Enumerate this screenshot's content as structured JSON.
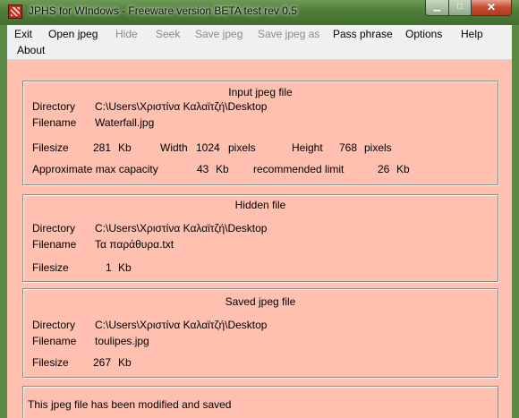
{
  "window": {
    "title": "JPHS for WIndows - Freeware version BETA test rev 0.5",
    "min_glyph": "▁",
    "max_glyph": "□",
    "close_glyph": "✕"
  },
  "menu": {
    "exit": "Exit",
    "open_jpeg": "Open jpeg",
    "hide": "Hide",
    "seek": "Seek",
    "save_jpeg": "Save jpeg",
    "save_jpeg_as": "Save jpeg as",
    "pass_phrase": "Pass phrase",
    "options": "Options",
    "help": "Help",
    "about": "About"
  },
  "input_jpeg": {
    "title": "Input jpeg file",
    "directory_label": "Directory",
    "directory": "C:\\Users\\Χριστίνα Καλαϊτζή\\Desktop",
    "filename_label": "Filename",
    "filename": "Waterfall.jpg",
    "filesize_label": "Filesize",
    "filesize": "281",
    "filesize_unit": "Kb",
    "width_label": "Width",
    "width": "1024",
    "width_unit": "pixels",
    "height_label": "Height",
    "height": "768",
    "height_unit": "pixels",
    "capacity_label": "Approximate max capacity",
    "capacity": "43",
    "capacity_unit": "Kb",
    "limit_label": "recommended limit",
    "limit": "26",
    "limit_unit": "Kb"
  },
  "hidden_file": {
    "title": "Hidden file",
    "directory_label": "Directory",
    "directory": "C:\\Users\\Χριστίνα Καλαϊτζή\\Desktop",
    "filename_label": "Filename",
    "filename": "Τα παράθυρα.txt",
    "filesize_label": "Filesize",
    "filesize": "1",
    "filesize_unit": "Kb"
  },
  "saved_jpeg": {
    "title": "Saved jpeg file",
    "directory_label": "Directory",
    "directory": "C:\\Users\\Χριστίνα Καλαϊτζή\\Desktop",
    "filename_label": "Filename",
    "filename": "toulipes.jpg",
    "filesize_label": "Filesize",
    "filesize": "267",
    "filesize_unit": "Kb"
  },
  "status": {
    "message": "This jpeg file has been modified and saved"
  },
  "colors": {
    "client_background": "#ffc0b0",
    "titlebar": "#4f7f3a",
    "menubar": "#f0f0f0",
    "close_button": "#c54a2f"
  }
}
